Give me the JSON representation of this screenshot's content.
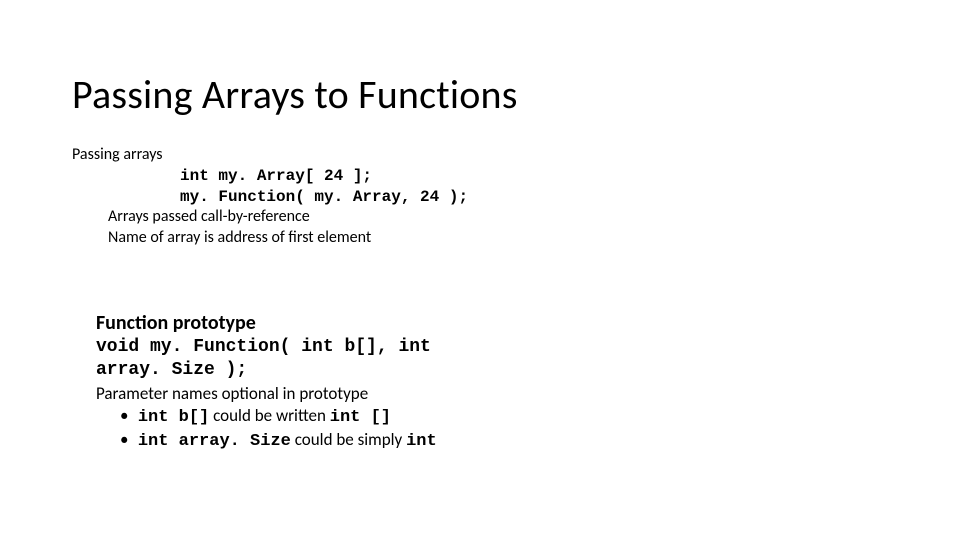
{
  "title": "Passing Arrays to Functions",
  "section1": {
    "heading": "Passing arrays",
    "code_line1": "int my. Array[ 24 ];",
    "code_line2": "my. Function( my. Array, 24 );",
    "note1": "Arrays passed call-by-reference",
    "note2": "Name of array is address of first element"
  },
  "section2": {
    "heading": "Function prototype",
    "proto_line1": "void my. Function( int b[], int",
    "proto_line2": "array. Size );",
    "param_note": "Parameter names optional in prototype",
    "bullets": [
      {
        "code1": "int b[]",
        "mid": " could be written ",
        "code2": "int []"
      },
      {
        "code1": "int array. Size",
        "mid": " could be simply ",
        "code2": "int"
      }
    ]
  }
}
